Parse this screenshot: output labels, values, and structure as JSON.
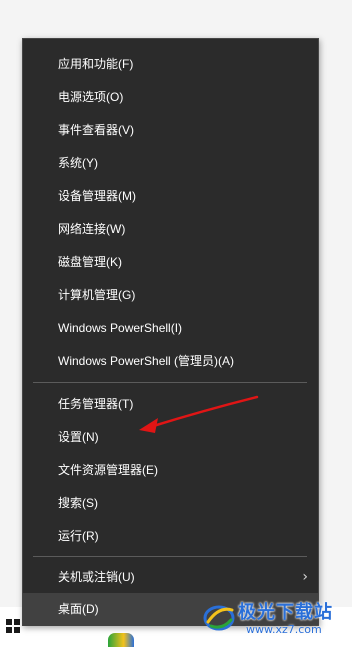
{
  "context_menu": {
    "group1": [
      {
        "label": "应用和功能(F)"
      },
      {
        "label": "电源选项(O)"
      },
      {
        "label": "事件查看器(V)"
      },
      {
        "label": "系统(Y)"
      },
      {
        "label": "设备管理器(M)"
      },
      {
        "label": "网络连接(W)"
      },
      {
        "label": "磁盘管理(K)"
      },
      {
        "label": "计算机管理(G)"
      },
      {
        "label": "Windows PowerShell(I)"
      },
      {
        "label": "Windows PowerShell (管理员)(A)"
      }
    ],
    "group2": [
      {
        "label": "任务管理器(T)"
      },
      {
        "label": "设置(N)"
      },
      {
        "label": "文件资源管理器(E)"
      },
      {
        "label": "搜索(S)"
      },
      {
        "label": "运行(R)"
      }
    ],
    "group3": [
      {
        "label": "关机或注销(U)",
        "has_submenu": true,
        "submenu_icon": "chevron-right-icon"
      },
      {
        "label": "桌面(D)",
        "hovered": true
      }
    ]
  },
  "annotation": {
    "arrow_color": "#e01515",
    "points_to": "设置(N)"
  },
  "watermark": {
    "title": "极光下载站",
    "url": "www.xz7.com"
  },
  "taskbar": {
    "start_icon": "windows-start-icon",
    "app_icon": "chrome-icon"
  },
  "colors": {
    "menu_background": "#2b2b2b",
    "menu_text": "#ffffff",
    "separator": "#5b5b5b",
    "hover_background": "#414141"
  }
}
